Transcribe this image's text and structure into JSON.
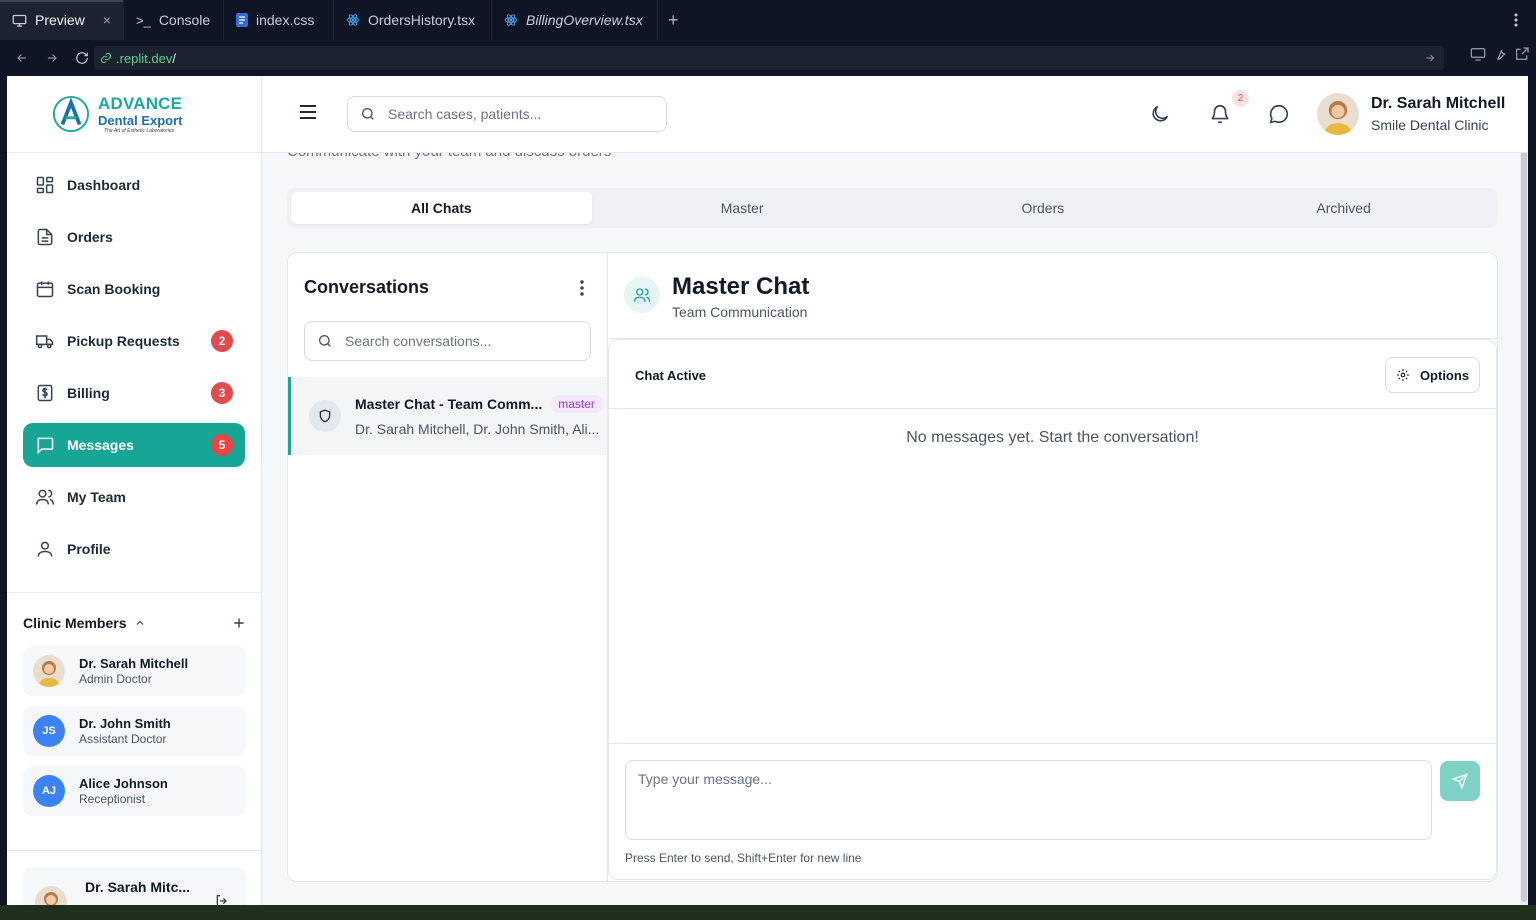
{
  "ide": {
    "tabs": [
      {
        "label": "Preview",
        "icon": "monitor-icon"
      },
      {
        "label": "Console",
        "icon": "terminal-icon"
      },
      {
        "label": "index.css",
        "icon": "css-file-icon"
      },
      {
        "label": "OrdersHistory.tsx",
        "icon": "react-icon"
      },
      {
        "label": "BillingOverview.tsx",
        "icon": "react-icon"
      }
    ],
    "url_prefix": "",
    "url_host": ".replit.dev",
    "url_path": "/"
  },
  "brand": {
    "line1": "ADVANCE",
    "line2": "Dental Export",
    "tagline": "The Art of Esthetic Laboratories"
  },
  "sidebar": {
    "items": [
      {
        "label": "Dashboard",
        "icon": "dashboard-icon"
      },
      {
        "label": "Orders",
        "icon": "file-icon"
      },
      {
        "label": "Scan Booking",
        "icon": "calendar-icon"
      },
      {
        "label": "Pickup Requests",
        "icon": "truck-icon",
        "badge": "2"
      },
      {
        "label": "Billing",
        "icon": "receipt-dollar-icon",
        "badge": "3"
      },
      {
        "label": "Messages",
        "icon": "message-icon",
        "badge": "5",
        "active": true
      },
      {
        "label": "My Team",
        "icon": "users-icon"
      },
      {
        "label": "Profile",
        "icon": "user-icon"
      }
    ],
    "members_title": "Clinic Members",
    "members": [
      {
        "name": "Dr. Sarah Mitchell",
        "role": "Admin Doctor",
        "initials": ""
      },
      {
        "name": "Dr. John Smith",
        "role": "Assistant Doctor",
        "initials": "JS"
      },
      {
        "name": "Alice Johnson",
        "role": "Receptionist",
        "initials": "AJ"
      }
    ],
    "current_user": "Dr. Sarah Mitc..."
  },
  "header": {
    "search_placeholder": "Search cases, patients...",
    "notification_count": "2",
    "user_name": "Dr. Sarah Mitchell",
    "clinic": "Smile Dental Clinic"
  },
  "page": {
    "subtitle": "Communicate with your team and discuss orders",
    "tabs": [
      "All Chats",
      "Master",
      "Orders",
      "Archived"
    ],
    "active_tab": "All Chats"
  },
  "conversations": {
    "title": "Conversations",
    "search_placeholder": "Search conversations...",
    "items": [
      {
        "title": "Master Chat - Team Comm...",
        "tag": "master",
        "participants": "Dr. Sarah Mitchell, Dr. John Smith, Ali..."
      }
    ]
  },
  "chat": {
    "title": "Master Chat",
    "subtitle": "Team Communication",
    "status": "Chat Active",
    "options_label": "Options",
    "empty": "No messages yet. Start the conversation!",
    "input_placeholder": "Type your message...",
    "hint": "Press Enter to send, Shift+Enter for new line"
  },
  "colors": {
    "accent": "#17a596",
    "badge": "#e5484d",
    "tag": "#9333ea"
  }
}
